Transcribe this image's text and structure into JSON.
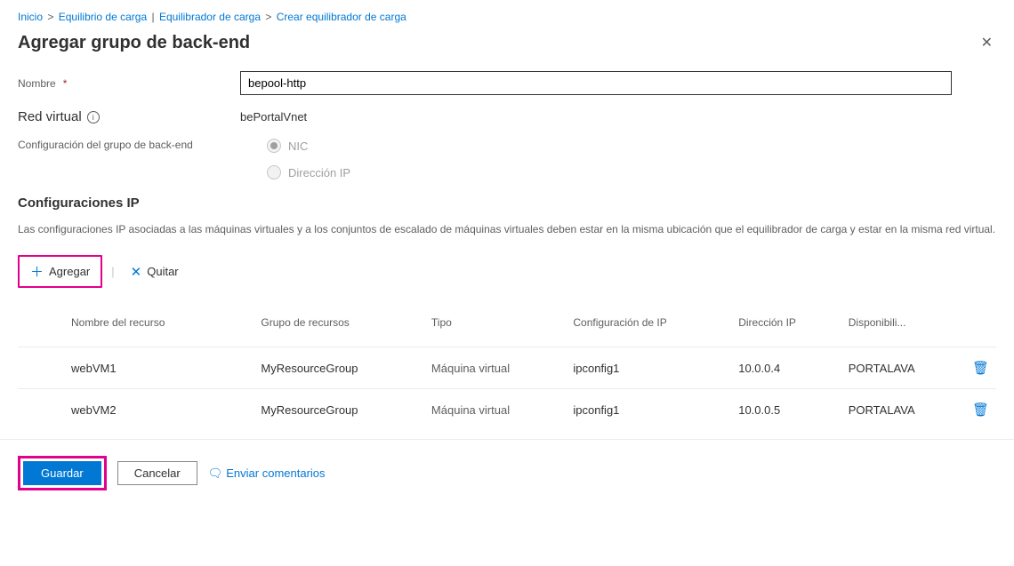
{
  "breadcrumb": {
    "home": "Inicio",
    "item1": "Equilibrio de carga",
    "item2": "Equilibrador de carga",
    "item3": "Crear equilibrador de carga"
  },
  "page_title": "Agregar grupo de back-end",
  "form": {
    "name_label": "Nombre",
    "name_value": "bepool-http",
    "vnet_label": "Red virtual",
    "vnet_value": "bePortalVnet",
    "config_label": "Configuración del grupo de back-end",
    "radio_nic": "NIC",
    "radio_ip": "Dirección IP"
  },
  "ip_section": {
    "title": "Configuraciones IP",
    "help": "Las configuraciones IP asociadas a las máquinas virtuales y a los conjuntos de escalado de máquinas virtuales deben estar en la misma ubicación que el equilibrador de carga y estar en la misma red virtual."
  },
  "toolbar": {
    "add": "Agregar",
    "remove": "Quitar"
  },
  "table": {
    "headers": {
      "resource": "Nombre del recurso",
      "rg": "Grupo de recursos",
      "type": "Tipo",
      "ipconfig": "Configuración de IP",
      "ip": "Dirección IP",
      "avail": "Disponibili..."
    },
    "rows": [
      {
        "resource": "webVM1",
        "rg": "MyResourceGroup",
        "type": "Máquina virtual",
        "ipconfig": "ipconfig1",
        "ip": "10.0.0.4",
        "avail": "PORTALAVA"
      },
      {
        "resource": "webVM2",
        "rg": "MyResourceGroup",
        "type": "Máquina virtual",
        "ipconfig": "ipconfig1",
        "ip": "10.0.0.5",
        "avail": "PORTALAVA"
      }
    ]
  },
  "footer": {
    "save": "Guardar",
    "cancel": "Cancelar",
    "feedback": "Enviar comentarios"
  }
}
